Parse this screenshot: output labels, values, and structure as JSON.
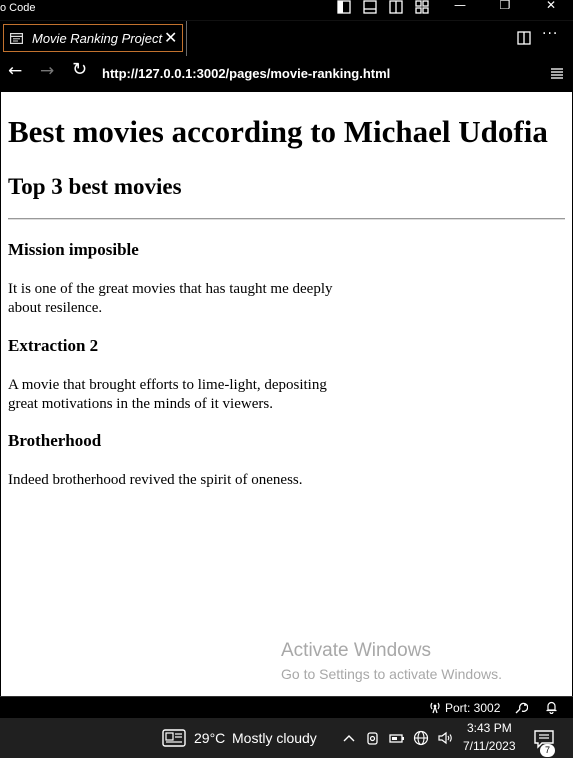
{
  "app": {
    "title": "o Code"
  },
  "tabs": [
    {
      "label": "Movie Ranking Project"
    }
  ],
  "address_bar": {
    "url": "http://127.0.0.1:3002/pages/movie-ranking.html"
  },
  "page": {
    "heading": "Best movies according to Michael Udofia",
    "subheading": "Top 3 best movies",
    "movies": [
      {
        "title": "Mission imposible",
        "description": "It is one of the great movies that has taught me deeply about resilence."
      },
      {
        "title": "Extraction 2",
        "description": "A movie that brought efforts to lime-light, depositing great motivations in the minds of it viewers."
      },
      {
        "title": "Brotherhood",
        "description": "Indeed brotherhood revived the spirit of oneness."
      }
    ]
  },
  "watermark": {
    "title": "Activate Windows",
    "subtitle": "Go to Settings to activate Windows."
  },
  "statusbar": {
    "port_label": "Port: 3002"
  },
  "taskbar": {
    "weather_temp": "29°C",
    "weather_desc": "Mostly cloudy",
    "time": "3:43 PM",
    "date": "7/11/2023",
    "notification_count": "7"
  },
  "colors": {
    "tab_border": "#c2722e",
    "page_bg": "#ffffff",
    "chrome_bg": "#000000",
    "taskbar_bg": "#202020"
  }
}
